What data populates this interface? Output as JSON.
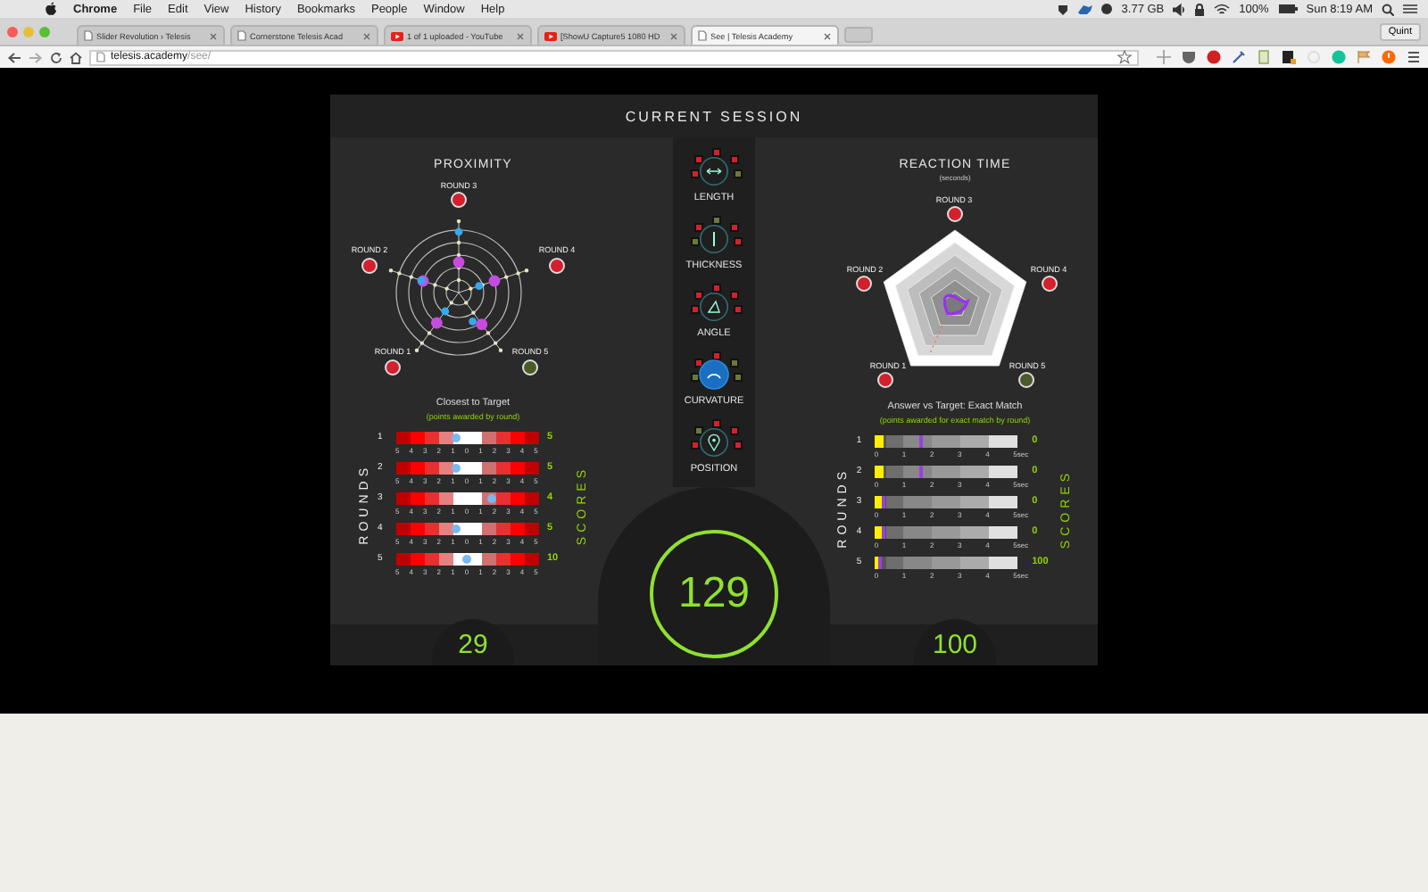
{
  "menu_bar": {
    "app": "Chrome",
    "items": [
      "File",
      "Edit",
      "View",
      "History",
      "Bookmarks",
      "People",
      "Window",
      "Help"
    ],
    "memory": "3.77 GB",
    "battery": "100%",
    "clock": "Sun 8:19 AM"
  },
  "tabs": [
    {
      "label": "Slider Revolution › Telesis",
      "kind": "page",
      "selected": false
    },
    {
      "label": "Cornerstone Telesis Acad",
      "kind": "page",
      "selected": false
    },
    {
      "label": "1 of 1 uploaded - YouTube",
      "kind": "video",
      "selected": false
    },
    {
      "label": "[ShowU Capture5 1080 HD",
      "kind": "video",
      "selected": false
    },
    {
      "label": "See | Telesis Academy",
      "kind": "page",
      "selected": true
    }
  ],
  "profile": "Quint",
  "address": {
    "host": "telesis.academy",
    "path": "/see/"
  },
  "session": {
    "title": "CURRENT SESSION",
    "proximity": {
      "title": "PROXIMITY",
      "rounds": [
        {
          "label": "ROUND 3",
          "color": "#d4202c"
        },
        {
          "label": "ROUND 2",
          "color": "#d4202c"
        },
        {
          "label": "ROUND 4",
          "color": "#d4202c"
        },
        {
          "label": "ROUND 1",
          "color": "#d4202c"
        },
        {
          "label": "ROUND 5",
          "color": "#4a5a2a"
        }
      ],
      "subtitle": "Closest to Target",
      "note": "(points awarded by round)",
      "rounds_label": "ROUNDS",
      "scores_label": "SCORES",
      "rows": [
        {
          "number": "1",
          "level": 0.42,
          "ticks": [
            "5",
            "4",
            "3",
            "2",
            "1",
            "0",
            "1",
            "2",
            "3",
            "4",
            "5"
          ],
          "score": "5"
        },
        {
          "number": "2",
          "level": 0.42,
          "ticks": [
            "5",
            "4",
            "3",
            "2",
            "1",
            "0",
            "1",
            "2",
            "3",
            "4",
            "5"
          ],
          "score": "5"
        },
        {
          "number": "3",
          "level": 0.67,
          "ticks": [
            "5",
            "4",
            "3",
            "2",
            "1",
            "0",
            "1",
            "2",
            "3",
            "4",
            "5"
          ],
          "score": "4"
        },
        {
          "number": "4",
          "level": 0.42,
          "ticks": [
            "5",
            "4",
            "3",
            "2",
            "1",
            "0",
            "1",
            "2",
            "3",
            "4",
            "5"
          ],
          "score": "5"
        },
        {
          "number": "5",
          "level": 0.5,
          "ticks": [
            "5",
            "4",
            "3",
            "2",
            "1",
            "0",
            "1",
            "2",
            "3",
            "4",
            "5"
          ],
          "score": "10"
        }
      ],
      "total": "29"
    },
    "skills": [
      {
        "label": "LENGTH",
        "kind": "length",
        "selected": false,
        "indicators": [
          {
            "color": "#d4202c"
          },
          {
            "color": "#d4202c"
          },
          {
            "color": "#d4202c"
          },
          {
            "color": "#d4202c"
          },
          {
            "color": "#6b7a3a"
          }
        ]
      },
      {
        "label": "THICKNESS",
        "kind": "thickness",
        "selected": false,
        "indicators": [
          {
            "color": "#6b7a3a"
          },
          {
            "color": "#d4202c"
          },
          {
            "color": "#d4202c"
          },
          {
            "color": "#6b7a3a"
          },
          {
            "color": "#d4202c"
          }
        ]
      },
      {
        "label": "ANGLE",
        "kind": "angle",
        "selected": false,
        "indicators": [
          {
            "color": "#d4202c"
          },
          {
            "color": "#d4202c"
          },
          {
            "color": "#d4202c"
          },
          {
            "color": "#d4202c"
          },
          {
            "color": "#d4202c"
          }
        ]
      },
      {
        "label": "CURVATURE",
        "kind": "curvature",
        "selected": true,
        "indicators": [
          {
            "color": "#d4202c"
          },
          {
            "color": "#d4202c"
          },
          {
            "color": "#6b7a3a"
          },
          {
            "color": "#6b7a3a"
          },
          {
            "color": "#6b7a3a"
          }
        ]
      },
      {
        "label": "POSITION",
        "kind": "position",
        "selected": false,
        "indicators": [
          {
            "color": "#d4202c"
          },
          {
            "color": "#6b7a3a"
          },
          {
            "color": "#d4202c"
          },
          {
            "color": "#d4202c"
          },
          {
            "color": "#d4202c"
          }
        ]
      }
    ],
    "total": "129",
    "reaction_time": {
      "title": "REACTION TIME",
      "unit_note": "(seconds)",
      "rounds": [
        {
          "label": "ROUND 3",
          "color": "#d4202c"
        },
        {
          "label": "ROUND 2",
          "color": "#d4202c"
        },
        {
          "label": "ROUND 4",
          "color": "#d4202c"
        },
        {
          "label": "ROUND 1",
          "color": "#d4202c"
        },
        {
          "label": "ROUND 5",
          "color": "#4a5a2a"
        }
      ],
      "subtitle": "Answer vs Target: Exact Match",
      "note": "(points awarded for exact match by round)",
      "rounds_label": "ROUNDS",
      "scores_label": "SCORES",
      "rows": [
        {
          "number": "1",
          "level": 0.06,
          "marker": {
            "level": 0.33
          },
          "ticks": [
            "0",
            "1",
            "2",
            "3",
            "4",
            "5"
          ],
          "unit": "sec",
          "score": "0"
        },
        {
          "number": "2",
          "level": 0.06,
          "marker": {
            "level": 0.33
          },
          "ticks": [
            "0",
            "1",
            "2",
            "3",
            "4",
            "5"
          ],
          "unit": "sec",
          "score": "0"
        },
        {
          "number": "3",
          "level": 0.06,
          "marker": {
            "level": 0.06
          },
          "ticks": [
            "0",
            "1",
            "2",
            "3",
            "4",
            "5"
          ],
          "unit": "sec",
          "score": "0"
        },
        {
          "number": "4",
          "level": 0.06,
          "marker": {
            "level": 0.06
          },
          "ticks": [
            "0",
            "1",
            "2",
            "3",
            "4",
            "5"
          ],
          "unit": "sec",
          "score": "0"
        },
        {
          "number": "5",
          "level": 0.04,
          "marker": {
            "level": 0.04
          },
          "ticks": [
            "0",
            "1",
            "2",
            "3",
            "4",
            "5"
          ],
          "unit": "sec",
          "score": "100"
        }
      ],
      "total": "100"
    }
  }
}
